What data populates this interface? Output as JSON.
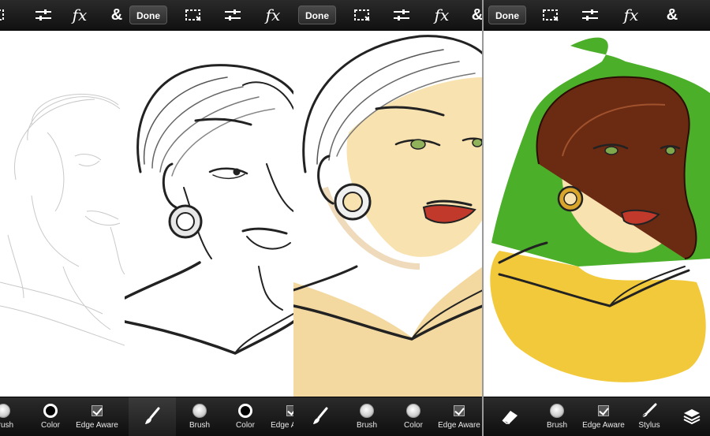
{
  "panels": [
    {
      "id": "panel-1",
      "top_icons": [
        "adjust-sliders-icon",
        "fx-icon",
        "ampersand-icon"
      ],
      "fx_label": "fx",
      "amp_label": "&",
      "bottom": [
        {
          "icon": "brush-size-icon",
          "label": "Brush"
        },
        {
          "icon": "color-icon",
          "label": "Color"
        },
        {
          "icon": "edge-aware-checkbox-icon",
          "label": "Edge Aware"
        }
      ]
    },
    {
      "id": "panel-2",
      "done_label": "Done",
      "fx_label": "fx",
      "bottom": [
        {
          "icon": "brush-icon",
          "label": ""
        },
        {
          "icon": "brush-size-icon",
          "label": "Brush"
        },
        {
          "icon": "color-icon",
          "label": "Color"
        },
        {
          "icon": "edge-aware-checkbox-icon",
          "label": "Edge Aware"
        }
      ]
    },
    {
      "id": "panel-3",
      "done_label": "Done",
      "fx_label": "fx",
      "bottom": [
        {
          "icon": "brush-icon",
          "label": ""
        },
        {
          "icon": "brush-size-icon",
          "label": "Brush"
        },
        {
          "icon": "color-icon",
          "label": "Color"
        },
        {
          "icon": "edge-aware-checkbox-icon",
          "label": "Edge Aware"
        }
      ]
    },
    {
      "id": "panel-4",
      "done_label": "Done",
      "fx_label": "fx",
      "amp_label": "&",
      "bottom": [
        {
          "icon": "eraser-icon",
          "label": ""
        },
        {
          "icon": "brush-size-icon",
          "label": "Brush"
        },
        {
          "icon": "edge-aware-checkbox-icon",
          "label": "Edge Aware"
        },
        {
          "icon": "stylus-icon",
          "label": "Stylus"
        },
        {
          "icon": "layers-icon",
          "label": ""
        }
      ]
    }
  ],
  "colors": {
    "toolbar": "#1a1a1a",
    "skin": "#f8e2b0",
    "lips": "#c0392b",
    "hair_brown": "#6b2a12",
    "background_green": "#4caf2a",
    "shirt_yellow": "#f2c93a",
    "eyes_green": "#7fa84c"
  }
}
